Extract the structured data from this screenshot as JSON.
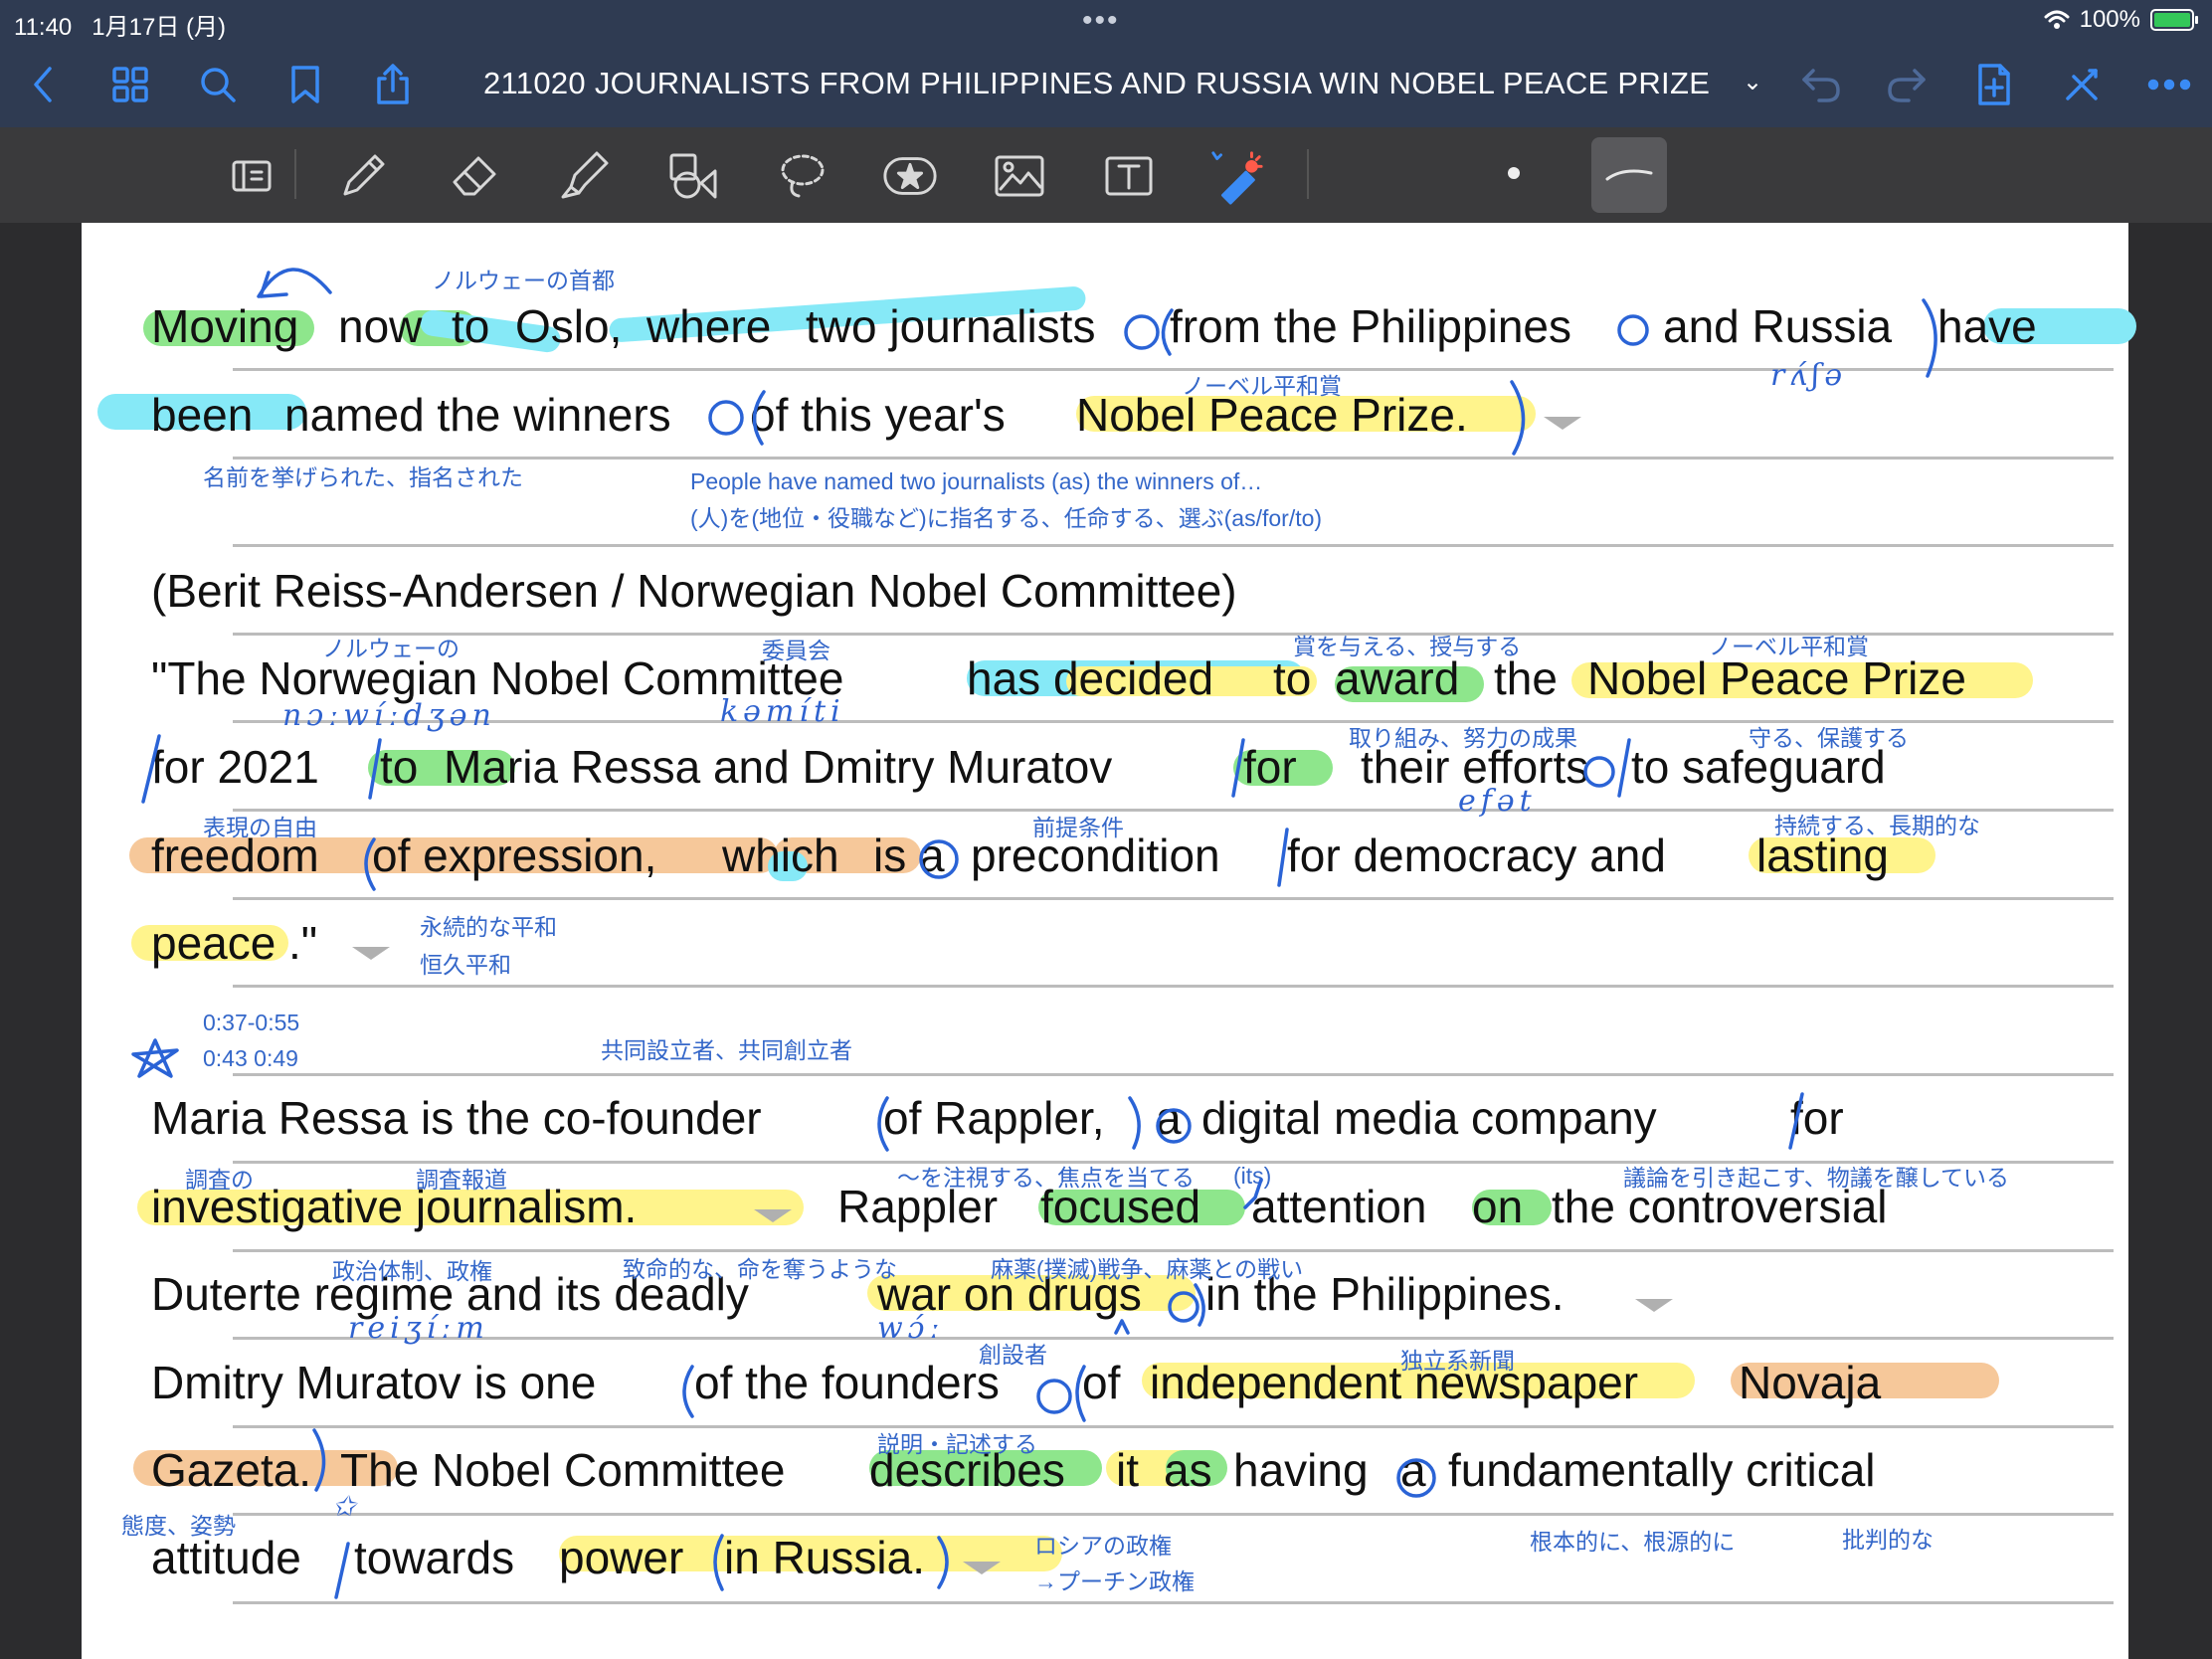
{
  "status_bar": {
    "time": "11:40",
    "date": "1月17日 (月)",
    "battery": "100%"
  },
  "nav": {
    "title": "211020 JOURNALISTS FROM PHILIPPINES AND RUSSIA WIN NOBEL PEACE PRIZE"
  },
  "colors": {
    "yellow": "#fff48c",
    "green": "#8ee68c",
    "cyan": "#86e9f7",
    "orange": "#f6c89a",
    "ink": "#2a63d6",
    "note": "#3467c9"
  },
  "icons": [
    "back-icon",
    "grid-icon",
    "search-icon",
    "bookmark-icon",
    "share-icon",
    "undo-icon",
    "redo-icon",
    "add-page-icon",
    "close-icon",
    "more-icon",
    "read-mode-icon",
    "pen-icon",
    "eraser-icon",
    "highlighter-icon",
    "shapes-icon",
    "lasso-icon",
    "elements-icon",
    "image-icon",
    "text-icon",
    "laser-icon",
    "stroke-style-icon"
  ],
  "text": {
    "l1": [
      "Moving",
      "now",
      "to",
      "Oslo,",
      "where",
      "two journalists",
      "from the Philippines",
      "and Russia",
      "have"
    ],
    "l2": [
      "been",
      "named the winners",
      "of this year's",
      "Nobel Peace Prize."
    ],
    "l3": "(Berit Reiss-Andersen / Norwegian Nobel Committee)",
    "l4": [
      "\"The Norwegian Nobel Committee",
      "has decided",
      "to",
      "award",
      "the",
      "Nobel Peace Prize"
    ],
    "l5": [
      "for 2021",
      "to",
      "Maria Ressa and Dmitry Muratov",
      "for",
      "their efforts",
      "to safeguard"
    ],
    "l6": [
      "freedom",
      "of expression,",
      "which",
      "is",
      "a",
      "precondition",
      "for democracy and",
      "lasting"
    ],
    "l7": [
      "peace",
      ".\""
    ],
    "l8": [
      "Maria Ressa is the co-founder",
      "of Rappler,",
      "a",
      "digital media company",
      "for"
    ],
    "l9": [
      "investigative journalism.",
      "Rappler",
      "focused",
      "attention",
      "on",
      "the controversial"
    ],
    "l10": [
      "Duterte regime and its deadly",
      "war on drugs",
      "in the Philippines."
    ],
    "l11": [
      "Dmitry Muratov is one",
      "of the founders",
      "of",
      "independent newspaper",
      "Novaja"
    ],
    "l12": [
      "Gazeta.",
      "The Nobel Committee",
      "describes",
      "it",
      "as",
      "having",
      "a",
      "fundamentally critical"
    ],
    "l13": [
      "attitude",
      "towards",
      "power",
      "in Russia."
    ]
  },
  "notes": {
    "n_oslo": "ノルウェーの首都",
    "n_prize1": "ノーベル平和賞",
    "n_named": "名前を挙げられた、指名された",
    "n_people": "People have named two journalists (as) the winners of…",
    "n_appoint": "(人)を(地位・役職など)に指名する、任命する、選ぶ(as/for/to)",
    "n_norw": "ノルウェーの",
    "n_comm": "委員会",
    "n_award": "賞を与える、授与する",
    "n_prize2": "ノーベル平和賞",
    "n_efforts": "取り組み、努力の成果",
    "n_safeguard": "守る、保護する",
    "n_freedom": "表現の自由",
    "n_precond": "前提条件",
    "n_lasting": "持続する、長期的な",
    "n_peace1": "永続的な平和",
    "n_peace2": "恒久平和",
    "n_time1": "0:37-0:55",
    "n_time2": "0:43 0:49",
    "n_cofounder": "共同設立者、共同創立者",
    "n_invest1": "調査の",
    "n_invest2": "調査報道",
    "n_focus": "〜を注視する、焦点を当てる",
    "n_its": "(its)",
    "n_controv": "議論を引き起こす、物議を醸している",
    "n_regime": "政治体制、政権",
    "n_deadly": "致命的な、命を奪うような",
    "n_war": "麻薬(撲滅)戦争、麻薬との戦い",
    "n_founder": "創設者",
    "n_indep": "独立系新聞",
    "n_describe": "説明・記述する",
    "n_attitude": "態度、姿勢",
    "n_russia1": "ロシアの政権",
    "n_russia2": "→プーチン政権",
    "n_fund": "根本的に、根源的に",
    "n_critical": "批判的な"
  },
  "handwriting": {
    "h_rasa": "rʌ́ʃə",
    "h_norw": "nɔːwíːdʒən",
    "h_comm": "kəmíti",
    "h_efat": "efət",
    "h_regime": "reiʒíːm",
    "h_war": "wɔ́ː",
    "h_time_star": "✩"
  }
}
